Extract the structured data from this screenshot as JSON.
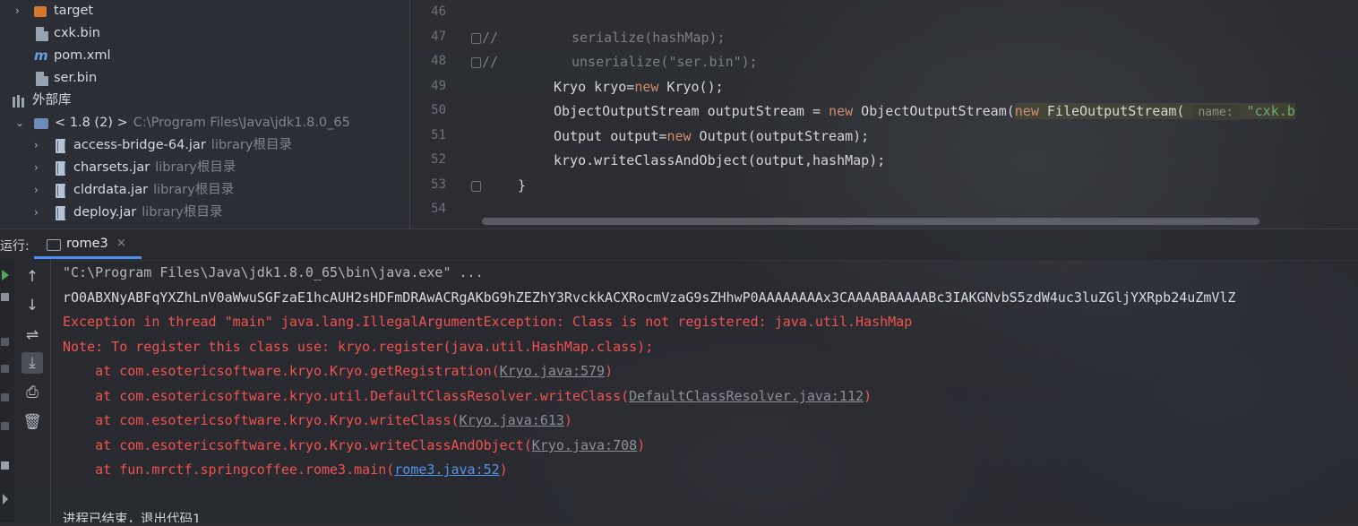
{
  "project_tree": {
    "items": [
      {
        "label": "target",
        "sub": "",
        "icon": "folder-icon",
        "chevron": "›"
      },
      {
        "label": "cxk.bin",
        "sub": "",
        "icon": "file-icon",
        "chevron": ""
      },
      {
        "label": "pom.xml",
        "sub": "",
        "icon": "maven-icon",
        "chevron": ""
      },
      {
        "label": "ser.bin",
        "sub": "",
        "icon": "file-icon",
        "chevron": ""
      },
      {
        "label": "外部库",
        "sub": "",
        "icon": "library-icon",
        "chevron": "⌄"
      },
      {
        "label": "< 1.8 (2) >",
        "sub": "C:\\Program Files\\Java\\jdk1.8.0_65",
        "icon": "sdk-icon",
        "chevron": "⌄"
      },
      {
        "label": "access-bridge-64.jar",
        "sub": "library根目录",
        "icon": "jar-icon",
        "chevron": "›"
      },
      {
        "label": "charsets.jar",
        "sub": "library根目录",
        "icon": "jar-icon",
        "chevron": "›"
      },
      {
        "label": "cldrdata.jar",
        "sub": "library根目录",
        "icon": "jar-icon",
        "chevron": "›"
      },
      {
        "label": "deploy.jar",
        "sub": "library根目录",
        "icon": "jar-icon",
        "chevron": "›"
      }
    ]
  },
  "editor": {
    "line_numbers": [
      "46",
      "47",
      "48",
      "49",
      "50",
      "51",
      "52",
      "53",
      "54"
    ],
    "lines": {
      "l47_comment": "//",
      "l47_code": "serialize(hashMap);",
      "l48_comment": "//",
      "l48_code": "unserialize(\"ser.bin\");",
      "l49_a": "Kryo kryo=",
      "l49_kw": "new",
      "l49_b": " Kryo();",
      "l50_a": "ObjectOutputStream outputStream = ",
      "l50_kw1": "new",
      "l50_b": " ObjectOutputStream(",
      "l50_kw2": "new",
      "l50_c": " FileOutputStream(",
      "l50_hint": "name:",
      "l50_str": "\"cxk.b",
      "l51_a": "Output output=",
      "l51_kw": "new",
      "l51_b": " Output(outputStream);",
      "l52": "kryo.writeClassAndObject(output,hashMap);",
      "l53": "}"
    }
  },
  "run_bar": {
    "title": "运行:",
    "tab_label": "rome3",
    "tab_close": "×"
  },
  "console_toolbar": {
    "buttons": [
      "↑",
      "↓",
      "⇌",
      "⤓",
      "⎙",
      "🗑"
    ]
  },
  "console": {
    "cmd": "\"C:\\Program Files\\Java\\jdk1.8.0_65\\bin\\java.exe\" ...",
    "output": "rO0ABXNyABFqYXZhLnV0aWwuSGFzaE1hcAUH2sHDFmDRAwACRgAKbG9hZEZhY3RvckkACXRocmVzaG9sZHhwP0AAAAAAAAx3CAAAABAAAAABc3IAKGNvbS5zdW4uc3luZGljYXRpb24uZmVlZ",
    "exception": "Exception in thread \"main\" java.lang.IllegalArgumentException: Class is not registered: java.util.HashMap",
    "note": "Note: To register this class use: kryo.register(java.util.HashMap.class);",
    "stack": [
      {
        "prefix": "    at com.esotericsoftware.kryo.Kryo.getRegistration(",
        "link": "Kryo.java:579",
        "suffix": ")"
      },
      {
        "prefix": "    at com.esotericsoftware.kryo.util.DefaultClassResolver.writeClass(",
        "link": "DefaultClassResolver.java:112",
        "suffix": ")"
      },
      {
        "prefix": "    at com.esotericsoftware.kryo.Kryo.writeClass(",
        "link": "Kryo.java:613",
        "suffix": ")"
      },
      {
        "prefix": "    at com.esotericsoftware.kryo.Kryo.writeClassAndObject(",
        "link": "Kryo.java:708",
        "suffix": ")"
      },
      {
        "prefix": "    at fun.mrctf.springcoffee.rome3.main(",
        "link": "rome3.java:52",
        "suffix": ")"
      }
    ],
    "exit": "进程已结束，退出代码1"
  }
}
